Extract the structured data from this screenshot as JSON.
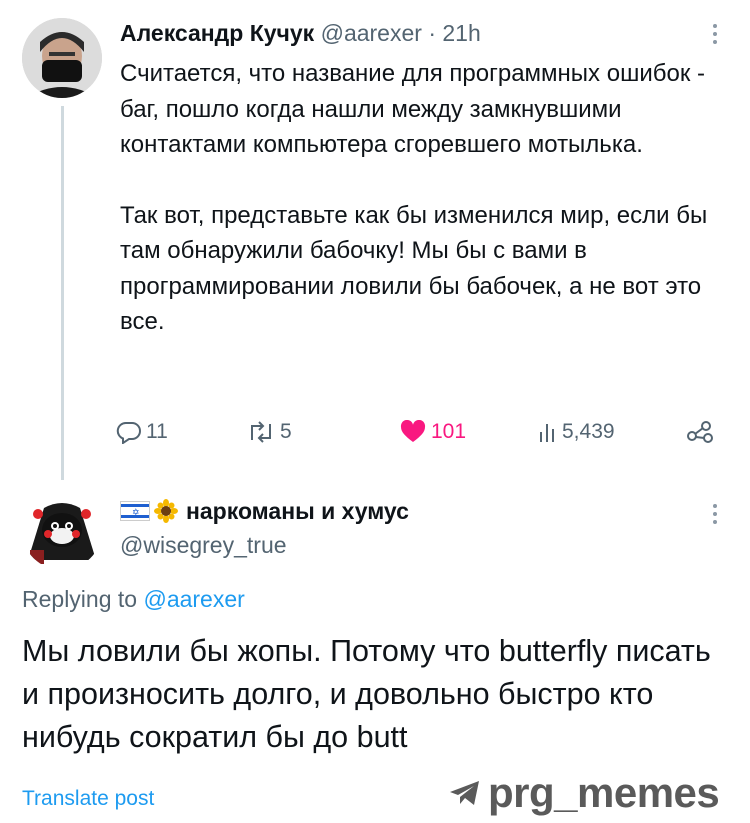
{
  "tweet": {
    "author_name": "Александр Кучук",
    "handle": "@aarexer",
    "separator": "·",
    "time": "21h",
    "paragraphs": [
      "Считается, что  название для программных ошибок - баг, пошло когда нашли между замкнувшими контактами компьютера сгоревшего мотылька.",
      "Так вот, представьте как бы изменился мир, если бы там обнаружили бабочку! Мы бы с вами в программировании ловили бы бабочек, а не вот это все."
    ],
    "actions": {
      "replies": "11",
      "reposts": "5",
      "likes": "101",
      "views": "5,439"
    }
  },
  "reply_tweet": {
    "author_name": "наркоманы и хумус",
    "handle": "@wisegrey_true",
    "replying_prefix": "Replying to",
    "replying_to": "@aarexer",
    "text": "Мы ловили бы жопы. Потому что butterfly писать и произносить долго, и довольно быстро кто нибудь сократил бы до butt",
    "translate_label": "Translate post"
  },
  "watermark": {
    "text": "prg_memes"
  },
  "colors": {
    "text": "#0f1419",
    "secondary": "#536471",
    "link": "#1d9bf0",
    "like": "#f91880",
    "thread_line": "#cfd9de"
  },
  "icons": [
    "reply-icon",
    "repost-icon",
    "heart-icon",
    "views-icon",
    "share-icon",
    "more-icon",
    "israel-flag-icon",
    "sunflower-icon",
    "telegram-icon"
  ]
}
